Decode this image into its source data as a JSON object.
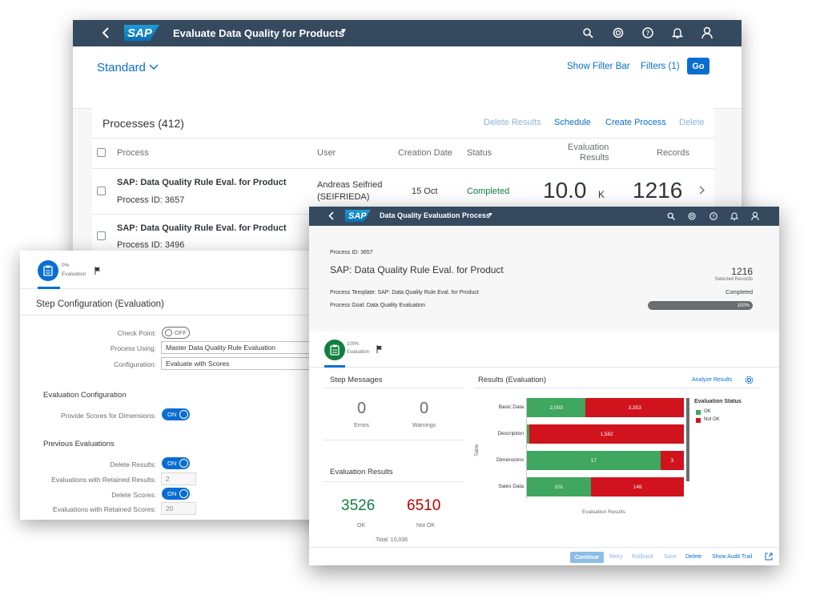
{
  "app": {
    "title": "Evaluate Data Quality for Products",
    "logo": "SAP",
    "shell_icons": [
      "search-icon",
      "copilot-icon",
      "help-icon",
      "notification-icon",
      "user-icon"
    ],
    "shell_color": "#354a5f"
  },
  "filter_bar": {
    "variant": "Standard",
    "show_filter_bar": "Show Filter Bar",
    "filters": "Filters (1)",
    "go": "Go"
  },
  "processes": {
    "title": "Processes (412)",
    "toolbar": {
      "delete_results": "Delete Results",
      "schedule": "Schedule",
      "create_process": "Create Process",
      "delete": "Delete"
    },
    "columns": {
      "process": "Process",
      "user": "User",
      "creation_date": "Creation Date",
      "status": "Status",
      "eval_results_1": "Evaluation",
      "eval_results_2": "Results",
      "records": "Records"
    },
    "rows": [
      {
        "name": "SAP: Data Quality Rule Eval. for Product",
        "pid": "Process ID: 3657",
        "user_1": "Andreas Seifried",
        "user_2": "(SEIFRIEDA)",
        "date": "15 Oct",
        "status": "Completed",
        "eval": "10.0",
        "eval_unit": "K",
        "records": "1216"
      },
      {
        "name": "SAP: Data Quality Rule Eval. for Product",
        "pid": "Process ID: 3496"
      }
    ]
  },
  "step_config": {
    "step_pct": "0%",
    "step_name": "Evaluation",
    "title": "Step Configuration (Evaluation)",
    "check_point_label": "Check Point:",
    "check_point_state": "OFF",
    "process_using_label": "Process Using:",
    "process_using_value": "Master Data Quality Rule Evaluation",
    "configuration_label": "Configuration:",
    "configuration_value": "Evaluate with Scores",
    "eval_config_title": "Evaluation Configuration",
    "provide_scores_label": "Provide Scores for Dimensions:",
    "on_label": "ON",
    "prev_eval_title": "Previous Evaluations",
    "delete_results_label": "Delete Results:",
    "retained_results_label": "Evaluations with Retained Results:",
    "retained_results_value": "2",
    "delete_scores_label": "Delete Scores:",
    "retained_scores_label": "Evaluations with Retained Scores:",
    "retained_scores_value": "20"
  },
  "detail": {
    "shell_title": "Data Quality Evaluation Process",
    "process_id": "Process ID: 3657",
    "title": "SAP: Data Quality Rule Eval. for Product",
    "records": "1216",
    "records_label": "Selected Records",
    "template": "Process Template: SAP: Data Quality Rule Eval. for Product",
    "status": "Completed",
    "goal": "Process Goal: Data Quality Evaluation",
    "progress": 100,
    "progress_label": "100%",
    "step_pct": "100%",
    "step_name": "Evaluation",
    "step_messages_title": "Step Messages",
    "errors_value": "0",
    "errors_label": "Errors",
    "warnings_value": "0",
    "warnings_label": "Warnings",
    "eval_results_title": "Evaluation Results",
    "ok_value": "3526",
    "ok_label": "OK",
    "nok_value": "6510",
    "nok_label": "Not OK",
    "total": "Total:  10,036",
    "results_title": "Results (Evaluation)",
    "analyze": "Analyze Results",
    "footer": {
      "continue": "Continue",
      "retry": "Retry",
      "rollback": "Rollback",
      "save": "Save",
      "delete": "Delete",
      "audit": "Show Audit Trail"
    }
  },
  "chart_data": {
    "type": "bar",
    "orientation": "horizontal",
    "stacked": true,
    "categories": [
      "Basic Data",
      "Description",
      "Dimensions",
      "Sales Data"
    ],
    "series": [
      {
        "name": "OK",
        "values": [
          2003,
          27,
          17,
          101
        ],
        "color": "#3fa75f"
      },
      {
        "name": "Not OK",
        "values": [
          3353,
          1582,
          3,
          146
        ],
        "color": "#d0131d"
      }
    ],
    "data_labels": {
      "OK": [
        "2,003",
        "",
        "17",
        "101"
      ],
      "Not OK": [
        "3,353",
        "1,582",
        "3",
        "146"
      ]
    },
    "normalized": true,
    "ylabel": "Table",
    "xlabel": "Evaluation Results",
    "legend_title": "Evaluation Status",
    "legend_position": "right"
  }
}
